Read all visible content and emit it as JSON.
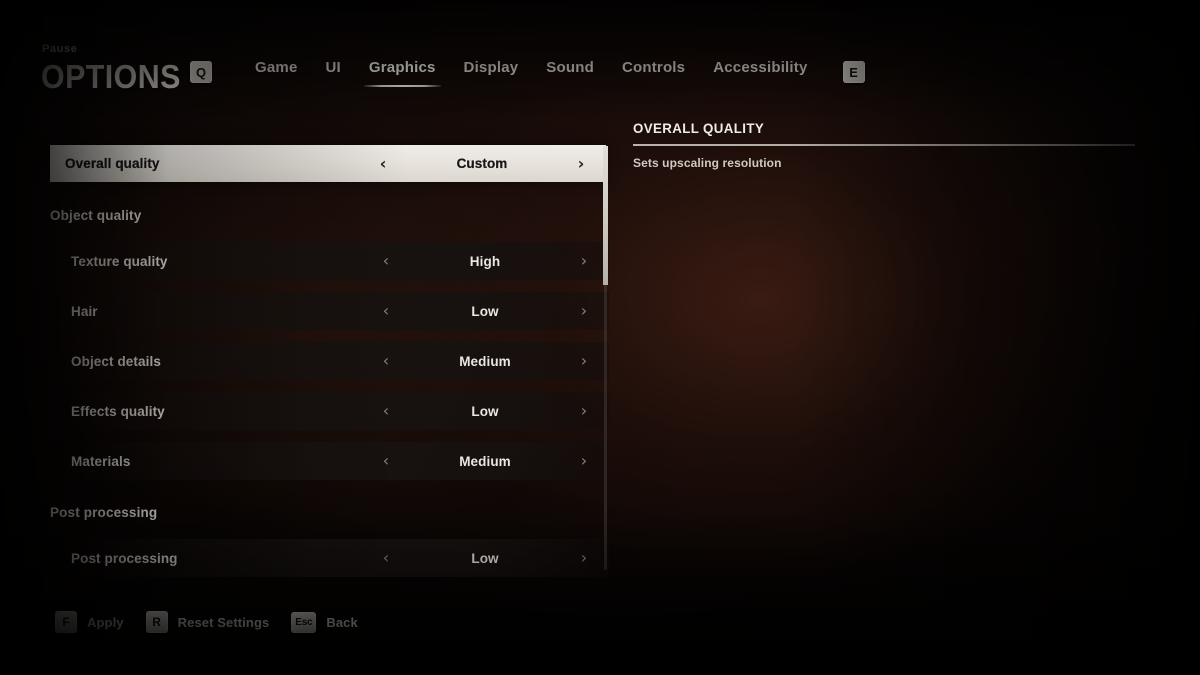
{
  "header": {
    "breadcrumb": "Pause",
    "title": "OPTIONS",
    "prev_tab_key": "Q",
    "next_tab_key": "E",
    "tabs": [
      {
        "label": "Game",
        "active": false
      },
      {
        "label": "UI",
        "active": false
      },
      {
        "label": "Graphics",
        "active": true
      },
      {
        "label": "Display",
        "active": false
      },
      {
        "label": "Sound",
        "active": false
      },
      {
        "label": "Controls",
        "active": false
      },
      {
        "label": "Accessibility",
        "active": false
      }
    ]
  },
  "settings_list": {
    "rows": [
      {
        "kind": "option",
        "label": "Overall quality",
        "value": "Custom",
        "selected": true
      },
      {
        "kind": "section",
        "label": "Object quality"
      },
      {
        "kind": "option",
        "label": "Texture quality",
        "value": "High",
        "selected": false
      },
      {
        "kind": "option",
        "label": "Hair",
        "value": "Low",
        "selected": false
      },
      {
        "kind": "option",
        "label": "Object details",
        "value": "Medium",
        "selected": false
      },
      {
        "kind": "option",
        "label": "Effects quality",
        "value": "Low",
        "selected": false
      },
      {
        "kind": "option",
        "label": "Materials",
        "value": "Medium",
        "selected": false
      },
      {
        "kind": "section",
        "label": "Post processing"
      },
      {
        "kind": "option",
        "label": "Post processing",
        "value": "Low",
        "selected": false
      }
    ],
    "left_chevron": "‹",
    "right_chevron": "›"
  },
  "description": {
    "title": "OVERALL QUALITY",
    "body": "Sets upscaling resolution"
  },
  "footer": {
    "actions": [
      {
        "key": "F",
        "label": "Apply",
        "wide": false
      },
      {
        "key": "R",
        "label": "Reset Settings",
        "wide": false
      },
      {
        "key": "Esc",
        "label": "Back",
        "wide": true
      }
    ]
  },
  "colors": {
    "selected_row_bg": "#e8e4dd",
    "text_primary": "#e3dfd8",
    "background": "#0a0605"
  }
}
